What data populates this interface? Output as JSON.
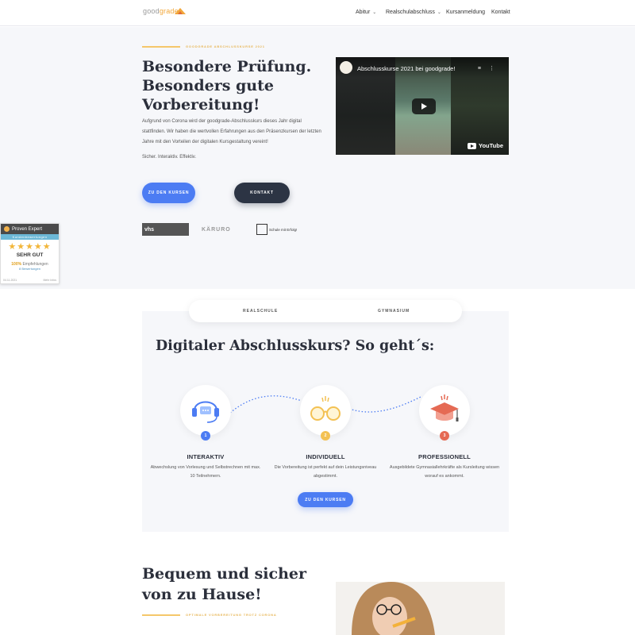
{
  "header": {
    "logo_prefix": "good",
    "logo_suffix": "grade",
    "nav": [
      {
        "label": "Abitur",
        "dropdown": true
      },
      {
        "label": "Realschulabschluss",
        "dropdown": true
      },
      {
        "label": "Kursanmeldung",
        "dropdown": false
      },
      {
        "label": "Kontakt",
        "dropdown": false
      }
    ]
  },
  "hero": {
    "eyebrow": "GOODGRADE ABSCHLUSSKURSE 2021",
    "title": "Besondere Prüfung. Besonders gute Vorbereitung!",
    "paragraph": "Aufgrund von Corona wird der goodgrade-Abschlusskurs dieses Jahr digital stattfinden. Wir haben die wertvollen Erfahrungen aus den Präsenzkursen der letzten Jahre mit den Vorteilen der digitalen Kursgestaltung vereint!",
    "tagline": "Sicher. Interaktiv. Effektiv.",
    "btn_courses": "ZU DEN KURSEN",
    "btn_contact": "KONTAKT",
    "partners": {
      "vhs": "vhs",
      "kaeru": "KÄRURO",
      "schule": "Schule mit Erfolg!"
    }
  },
  "video": {
    "title": "Abschlusskurse 2021 bei goodgrade!",
    "brand": "YouTube"
  },
  "proven_expert": {
    "brand": "Proven Expert",
    "subtitle": "Kundenbewertungen",
    "stars": "★★★★★",
    "grade": "SEHR GUT",
    "recommend_pct": "100%",
    "recommend_label": "Empfehlungen",
    "count": "8 Bewertungen",
    "date": "04.11.2021",
    "more": "Mehr Infos"
  },
  "tabs": [
    "REALSCHULE",
    "GYMNASIUM"
  ],
  "steps": {
    "title": "Digitaler Abschlusskurs? So geht´s:",
    "items": [
      {
        "num": "1",
        "title": "INTERAKTIV",
        "text": "Abwechslung von Vorlesung und Selbstrechnen mit max. 10 Teilnehmern.",
        "color": "#4c7cf3"
      },
      {
        "num": "2",
        "title": "INDIVIDUELL",
        "text": "Die Vorbereitung ist perfekt auf dein Leistungsniveau abgestimmt.",
        "color": "#f3c153"
      },
      {
        "num": "3",
        "title": "PROFESSIONELL",
        "text": "Ausgebildete Gymnasiallehrkräfte als Kursleitung wissen worauf es ankommt.",
        "color": "#e56a54"
      }
    ],
    "button": "ZU DEN KURSEN"
  },
  "lower": {
    "title": "Bequem und sicher von zu Hause!",
    "eyebrow": "OPTIMALE VORBEREITUNG TROTZ CORONA"
  },
  "colors": {
    "accent": "#4c7cf3",
    "dark": "#2c3444",
    "gold": "#f5c76a"
  }
}
